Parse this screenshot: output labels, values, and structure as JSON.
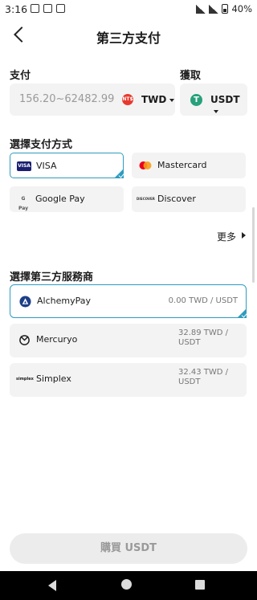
{
  "status_bar": {
    "time": "3:16",
    "battery": "40%"
  },
  "header": {
    "title": "第三方支付"
  },
  "pay": {
    "label": "支付",
    "placeholder": "156.20~62482.99",
    "currency": "TWD",
    "currency_icon_text": "NT$"
  },
  "receive": {
    "label": "獲取",
    "currency": "USDT",
    "currency_icon_text": "T"
  },
  "payment_methods": {
    "label": "選擇支付方式",
    "items": [
      {
        "label": "VISA",
        "icon": "visa-icon",
        "icon_text": "VISA",
        "selected": true
      },
      {
        "label": "Mastercard",
        "icon": "mastercard-icon",
        "icon_text": "",
        "selected": false
      },
      {
        "label": "Google Pay",
        "icon": "google-pay-icon",
        "icon_text": "G Pay",
        "selected": false
      },
      {
        "label": "Discover",
        "icon": "discover-icon",
        "icon_text": "DISCOVER",
        "selected": false
      }
    ],
    "more_label": "更多"
  },
  "providers": {
    "label": "選擇第三方服務商",
    "items": [
      {
        "name": "AlchemyPay",
        "rate": "0.00 TWD / USDT",
        "icon": "alchemypay-icon",
        "selected": true
      },
      {
        "name": "Mercuryo",
        "rate": "32.89 TWD / USDT",
        "icon": "mercuryo-icon",
        "selected": false
      },
      {
        "name": "Simplex",
        "rate": "32.43 TWD / USDT",
        "icon": "simplex-icon",
        "icon_text": "simplex",
        "selected": false
      }
    ]
  },
  "buy_button": {
    "label": "購買 USDT"
  },
  "colors": {
    "accent": "#2e9cbf",
    "tether": "#26a17b",
    "ntd": "#e8392e"
  }
}
